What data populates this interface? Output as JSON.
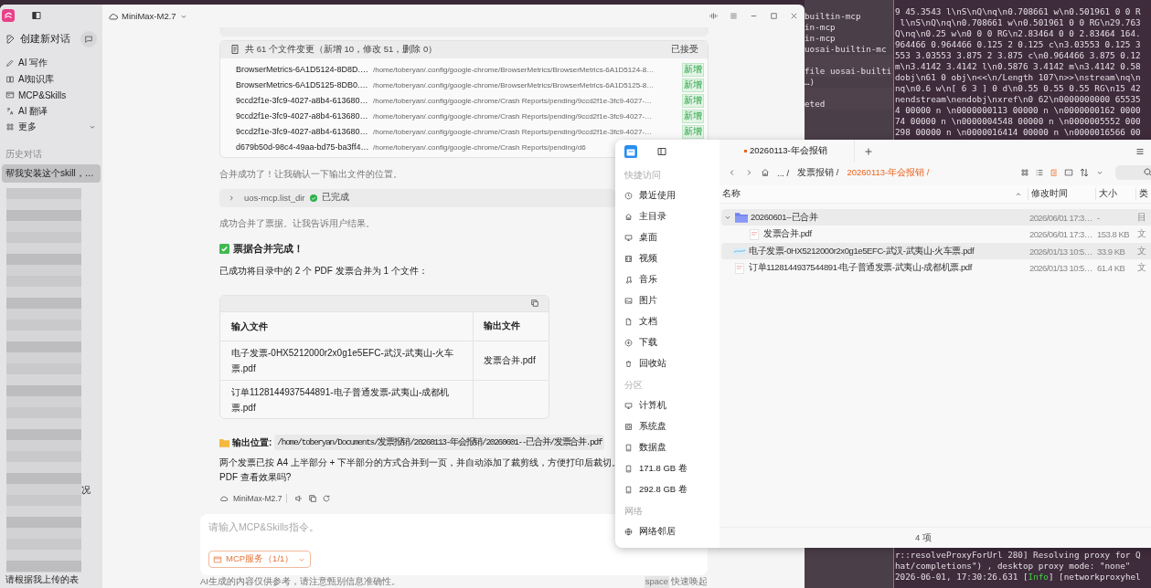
{
  "terminal": {
    "side_lines": [
      {
        "text": "builtin-mcp",
        "gap_before": false
      },
      {
        "text": "in-mcp",
        "gap_before": false
      },
      {
        "text": "in-mcp",
        "gap_before": false
      },
      {
        "text": "uosai-builtin-mc",
        "gap_before": false
      },
      {
        "text": "file uosai-builti",
        "gap_before": true
      },
      {
        "text": "…)",
        "gap_before": false
      },
      {
        "text": "eted",
        "gap_before": true
      }
    ],
    "lines": [
      "9 45.3543 l\\nS\\nQ\\nq\\n0.708661 w\\n0.501961 0 0 R",
      " l\\nS\\nQ\\nq\\n0.708661 w\\n0.501961 0 0 RG\\n29.763",
      "Q\\nq\\n0.25 w\\n0 0 0 RG\\n2.83464 0 0 2.83464 164.",
      "964466 0.964466 0.125 2 0.125 c\\n3.03553 0.125 3",
      "553 3.03553 3.875 2 3.875 c\\n0.964466 3.875 0.12",
      "m\\n3.4142 3.4142 l\\n0.5876 3.4142 m\\n3.4142 0.58",
      "dobj\\n61 0 obj\\n<<\\n/Length 107\\n>>\\nstream\\nq\\n",
      "nq\\n0.6 w\\n[ 6 3 ] 0 d\\n0.55 0.55 0.55 RG\\n15 42",
      "nendstream\\nendobj\\nxref\\n0 62\\n0000000000 65535",
      "4 00000 n \\n0000000113 00000 n \\n0000000162 0000",
      "74 00000 n \\n0000004548 00000 n \\n0000005552 000",
      "298 00000 n \\n0000016414 00000 n \\n0000016566 00"
    ],
    "log_lines": [
      "r::resolveProxyForUrl 280] Resolving proxy for Q",
      "hat/completions\") , desktop proxy mode: \"none\""
    ],
    "last_log": {
      "before": "2026-06-01, 17:30:26.631 [",
      "level": "Info",
      "after": "] [networkproxyhel"
    }
  },
  "chat": {
    "model": "MiniMax-M2.7",
    "sidebar": {
      "new_chat": "创建新对话",
      "nav": [
        {
          "label": "AI 写作",
          "expandable": false
        },
        {
          "label": "AI知识库",
          "expandable": false
        },
        {
          "label": "MCP&Skills",
          "expandable": false
        },
        {
          "label": "AI 翻译",
          "expandable": false
        },
        {
          "label": "更多",
          "expandable": true
        }
      ],
      "history_title": "历史对话",
      "history": [
        {
          "title": "帮我安装这个skill，…",
          "selected": true
        }
      ],
      "history_fragment": "况",
      "history_last": "请根据我上传的表"
    },
    "changes": {
      "summary": "共 61 个文件变更（新增 10，修改 51，删除 0）",
      "status": "已接受",
      "files": [
        {
          "name": "BrowserMetrics-6A1D5124-8D8D.…",
          "path": "/home/toberyan/.config/google-chrome/BrowserMetrics/BrowserMetrics-6A1D5124-8…",
          "badge": "新增"
        },
        {
          "name": "BrowserMetrics-6A1D5125-8DB0.…",
          "path": "/home/toberyan/.config/google-chrome/BrowserMetrics/BrowserMetrics-6A1D5125-8…",
          "badge": "新增"
        },
        {
          "name": "9ccd2f1e-3fc9-4027-a8b4-613680…",
          "path": "/home/toberyan/.config/google-chrome/Crash Reports/pending/9ccd2f1e-3fc9-4027-…",
          "badge": "新增"
        },
        {
          "name": "9ccd2f1e-3fc9-4027-a8b4-613680…",
          "path": "/home/toberyan/.config/google-chrome/Crash Reports/pending/9ccd2f1e-3fc9-4027-…",
          "badge": "新增"
        },
        {
          "name": "9ccd2f1e-3fc9-4027-a8b4-613680…",
          "path": "/home/toberyan/.config/google-chrome/Crash Reports/pending/9ccd2f1e-3fc9-4027-…",
          "badge": "新增"
        },
        {
          "name": "d679b50d-98c4-49aa-bd75-ba3ff4…",
          "path": "/home/toberyan/.config/google-chrome/Crash Reports/pending/d6"
        }
      ]
    },
    "note_1": "合并成功了！让我确认一下输出文件的位置。",
    "tool_call": {
      "name": "uos-mcp.list_dir",
      "status": "已完成",
      "expanded": false
    },
    "note_2": "成功合并了票据。让我告诉用户结果。",
    "heading": "票据合并完成！",
    "intro": "已成功将目录中的 2 个 PDF 发票合并为 1 个文件：",
    "table": {
      "columns": [
        "输入文件",
        "输出文件"
      ],
      "rows": [
        {
          "input": "电子发票-0HX5212000r2x0g1e5EFC-武汉-武夷山-火车票.pdf",
          "output": "发票合并.pdf"
        },
        {
          "input": "订单1128144937544891-电子普通发票-武夷山-成都机票.pdf"
        }
      ]
    },
    "output": {
      "label": "输出位置:",
      "path": "/home/toberyan/Documents/发票报销/20260113-年会报销/20260601--已合并/发票合并.pdf"
    },
    "summary_lines": [
      "两个发票已按 A4 上半部分 + 下半部分的方式合并到一页，并自动添加了裁剪线，方便打印后裁切。",
      "PDF 查看效果吗?"
    ],
    "footer_model": "MiniMax-M2.7",
    "composer": {
      "placeholder": "请输入MCP&Skills指令。",
      "service": "MCP服务（1/1）"
    },
    "disclaimer": "AI生成的内容仅供参考，请注意甄别信息准确性。",
    "shortcut_key": "space",
    "shortcut_label": "快速唤起"
  },
  "files": {
    "sidebar": [
      {
        "title": "快捷访问",
        "items": [
          "最近使用",
          "主目录",
          "桌面",
          "视频",
          "音乐",
          "图片",
          "文档",
          "下载",
          "回收站"
        ]
      },
      {
        "title": "分区",
        "items": [
          "计算机",
          "系统盘",
          "数据盘",
          "171.8 GB 卷",
          "292.8 GB 卷"
        ]
      },
      {
        "title": "网络",
        "items": [
          "网络邻居"
        ]
      }
    ],
    "tab": "20260113-年会报销",
    "breadcrumbs": [
      {
        "label": "... /",
        "current": false
      },
      {
        "label": "发票报销 /",
        "current": false
      },
      {
        "label": "20260113-年会报销 /",
        "current": true
      }
    ],
    "view_modes": [
      {
        "kind": "icons",
        "selected": false
      },
      {
        "kind": "list",
        "selected": false
      },
      {
        "kind": "tree",
        "selected": true
      },
      {
        "kind": "preview",
        "selected": false
      }
    ],
    "columns": [
      "名称",
      "修改时间",
      "大小",
      "类"
    ],
    "rows": [
      {
        "name": "20260601--已合并",
        "kind": "folder",
        "expanded": true,
        "selected": true,
        "modified": "2026/06/01 17:3…",
        "size": "-",
        "type": "目",
        "children": [
          {
            "name": "发票合并.pdf",
            "kind": "pdf",
            "selected": false,
            "modified": "2026/06/01 17:3…",
            "size": "153.8 KB",
            "type": "文"
          }
        ]
      },
      {
        "name": "电子发票-0HX5212000r2x0g1e5EFC-武汉-武夷山-火车票.pdf",
        "kind": "ticket",
        "selected": true,
        "modified": "2026/01/13 10:5…",
        "size": "33.9 KB",
        "type": "文"
      },
      {
        "name": "订单1128144937544891-电子普通发票-武夷山-成都机票.pdf",
        "kind": "pdf",
        "selected": false,
        "modified": "2026/01/13 10:5…",
        "size": "61.4 KB",
        "type": "文"
      }
    ],
    "status": "4 项"
  }
}
